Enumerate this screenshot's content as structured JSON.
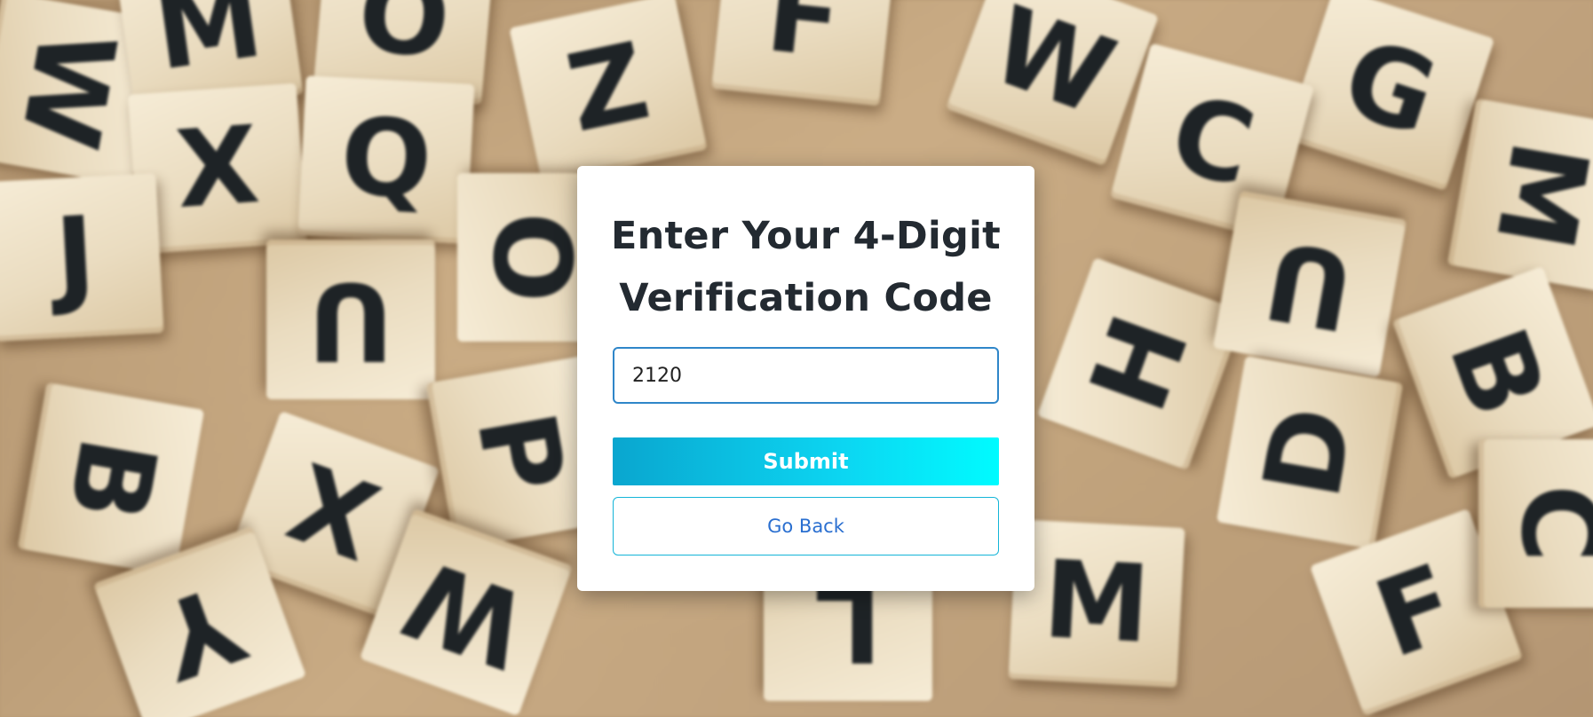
{
  "background": {
    "tiles": [
      {
        "letter": "W"
      },
      {
        "letter": "M"
      },
      {
        "letter": "O"
      },
      {
        "letter": "Z"
      },
      {
        "letter": "F"
      },
      {
        "letter": "W"
      },
      {
        "letter": "G"
      },
      {
        "letter": "X"
      },
      {
        "letter": "Q"
      },
      {
        "letter": "O"
      },
      {
        "letter": "C"
      },
      {
        "letter": "M"
      },
      {
        "letter": "J"
      },
      {
        "letter": "U"
      },
      {
        "letter": "H"
      },
      {
        "letter": "U"
      },
      {
        "letter": "B"
      },
      {
        "letter": "B"
      },
      {
        "letter": "X"
      },
      {
        "letter": "D"
      },
      {
        "letter": "P"
      },
      {
        "letter": "Y"
      },
      {
        "letter": "W"
      },
      {
        "letter": "L"
      },
      {
        "letter": "M"
      },
      {
        "letter": "F"
      },
      {
        "letter": "C"
      }
    ]
  },
  "form": {
    "title": "Enter Your 4-Digit Verification Code",
    "code_value": "2120",
    "submit_label": "Submit",
    "back_label": "Go Back"
  },
  "colors": {
    "title_text": "#232a31",
    "input_border": "#2f86c9",
    "submit_gradient_start": "#0aa6cf",
    "submit_gradient_end": "#00fbff",
    "back_text": "#2a6fd0",
    "back_border": "#14b5d8"
  }
}
